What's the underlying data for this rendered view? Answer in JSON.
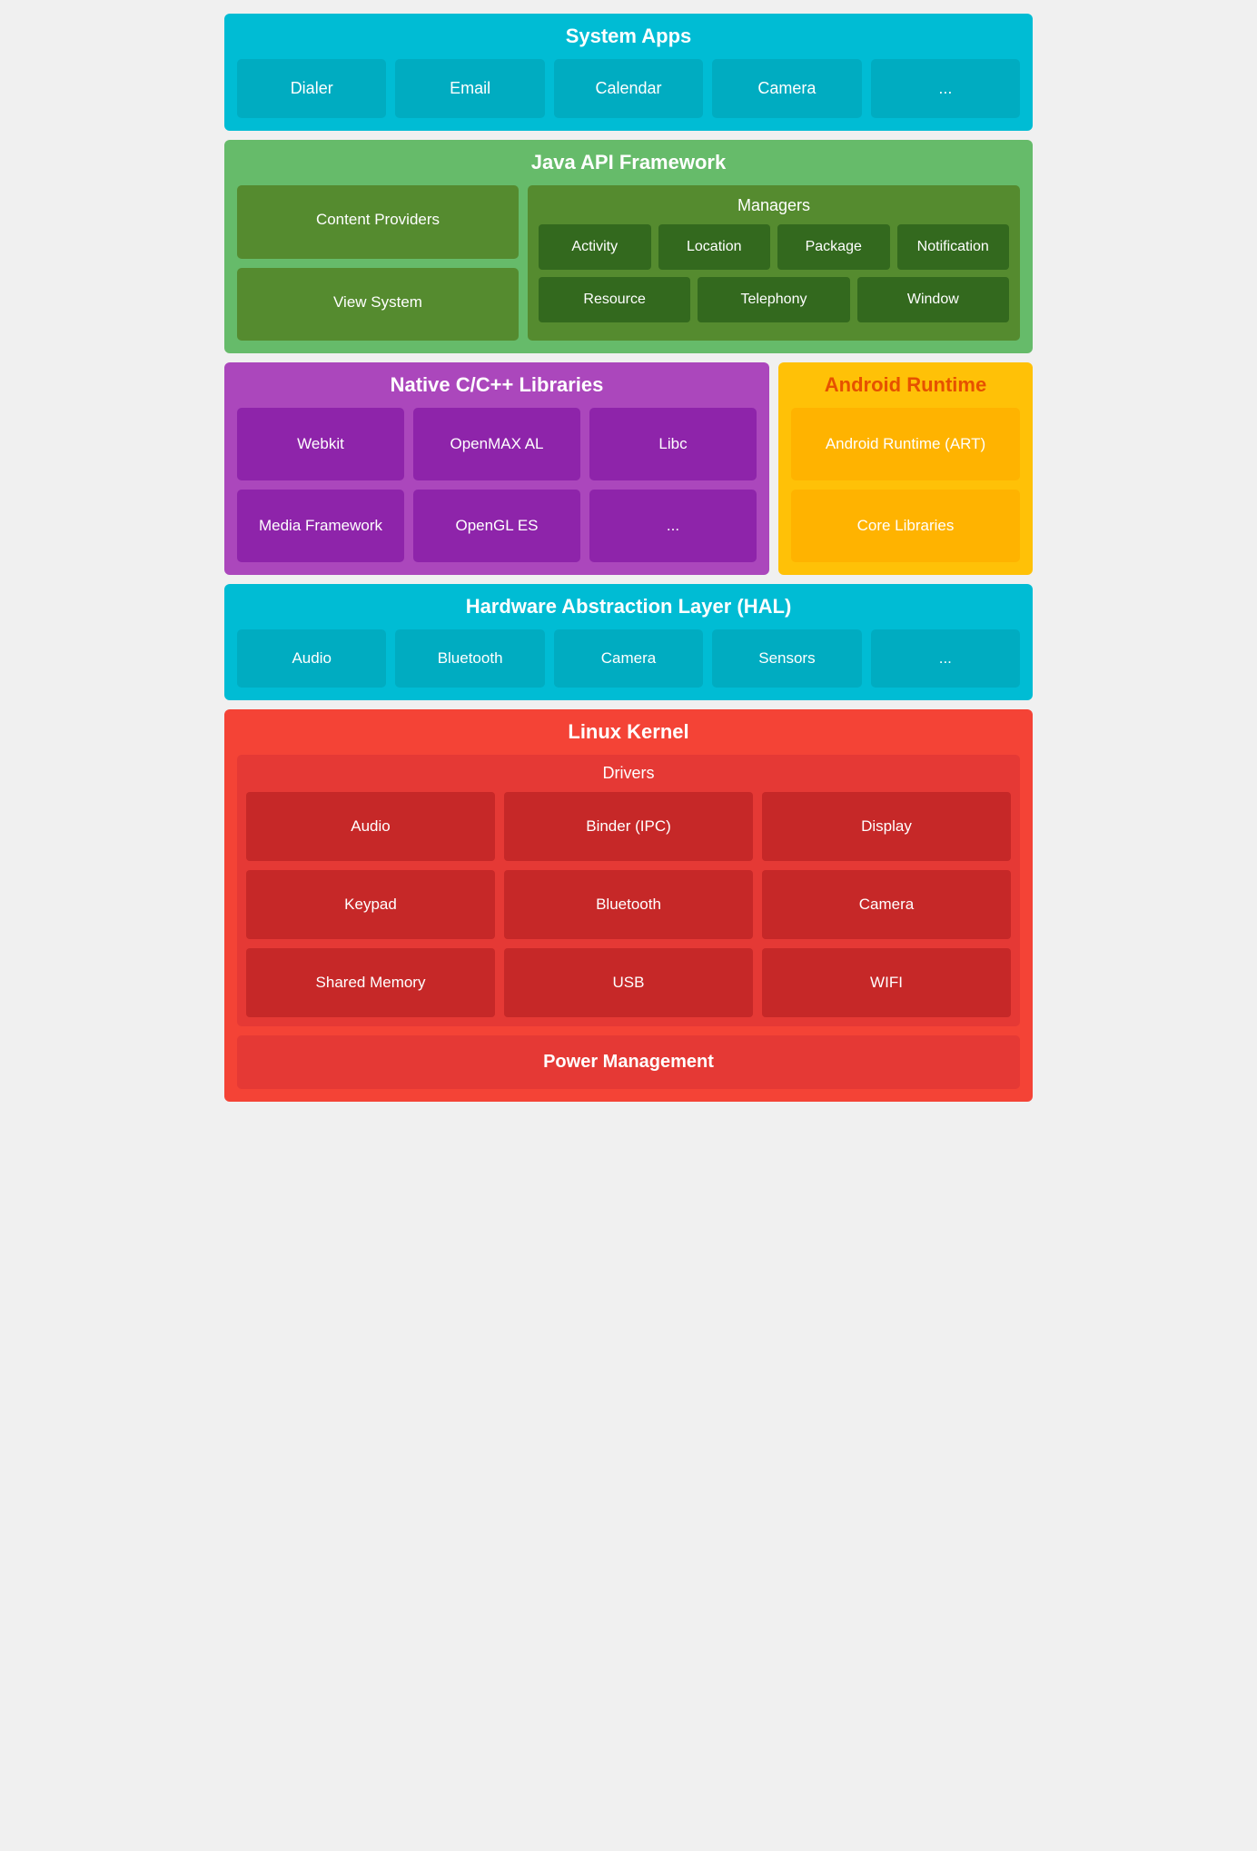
{
  "system_apps": {
    "title": "System Apps",
    "apps": [
      "Dialer",
      "Email",
      "Calendar",
      "Camera",
      "..."
    ]
  },
  "java_api": {
    "title": "Java API Framework",
    "left_boxes": [
      "Content Providers",
      "View System"
    ],
    "managers": {
      "title": "Managers",
      "row1": [
        "Activity",
        "Location",
        "Package",
        "Notification"
      ],
      "row2": [
        "Resource",
        "Telephony",
        "Window"
      ]
    }
  },
  "native_libs": {
    "title": "Native C/C++ Libraries",
    "libs": [
      "Webkit",
      "OpenMAX AL",
      "Libc",
      "Media Framework",
      "OpenGL ES",
      "..."
    ]
  },
  "android_runtime": {
    "title": "Android Runtime",
    "items": [
      "Android Runtime (ART)",
      "Core Libraries"
    ]
  },
  "hal": {
    "title": "Hardware Abstraction Layer (HAL)",
    "items": [
      "Audio",
      "Bluetooth",
      "Camera",
      "Sensors",
      "..."
    ]
  },
  "linux_kernel": {
    "title": "Linux Kernel",
    "drivers_title": "Drivers",
    "drivers": [
      "Audio",
      "Binder (IPC)",
      "Display",
      "Keypad",
      "Bluetooth",
      "Camera",
      "Shared Memory",
      "USB",
      "WIFI"
    ],
    "power_management": "Power Management"
  }
}
